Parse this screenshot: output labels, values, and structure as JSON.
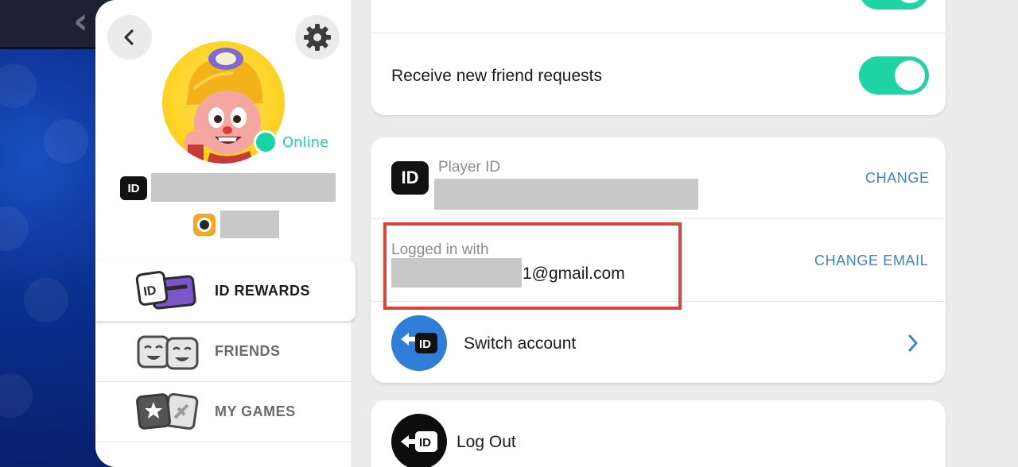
{
  "profile": {
    "status": "Online",
    "id_badge": "ID"
  },
  "nav": {
    "items": [
      {
        "label": "ID REWARDS",
        "active": true
      },
      {
        "label": "FRIENDS",
        "active": false
      },
      {
        "label": "MY GAMES",
        "active": false
      }
    ]
  },
  "settings": {
    "friend_requests_label": "Receive new friend requests",
    "friend_requests_on": true
  },
  "account": {
    "player_id_label": "Player ID",
    "player_id_action": "CHANGE",
    "logged_in_label": "Logged in with",
    "email_visible": "1@gmail.com",
    "email_action": "CHANGE EMAIL",
    "switch_label": "Switch account",
    "id_icon_text": "ID"
  },
  "logout": {
    "label": "Log Out"
  },
  "colors": {
    "accent_green": "#1ed3a4",
    "link_blue": "#3a86d0",
    "highlight_red": "#d9453a"
  }
}
